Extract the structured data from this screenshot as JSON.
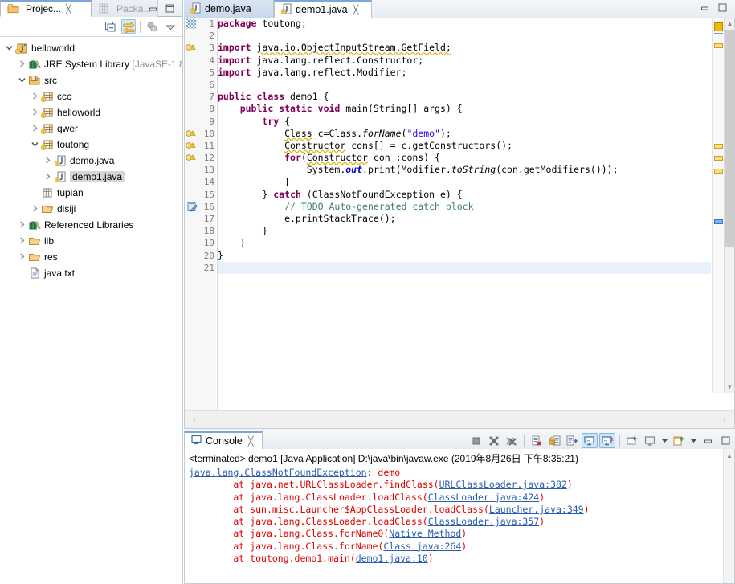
{
  "left_panel": {
    "tabs": [
      {
        "label": "Projec...",
        "icon": "project-explorer-icon",
        "active": true,
        "closable": true
      },
      {
        "label": "Packa...",
        "icon": "package-explorer-icon",
        "active": false,
        "closable": false
      }
    ],
    "window_controls": {
      "minimize": "minimize-icon",
      "maximize": "maximize-icon"
    },
    "toolbar": [
      {
        "name": "collapse-all-button",
        "icon": "collapse-all-icon",
        "selected": false
      },
      {
        "name": "link-with-editor-button",
        "icon": "link-editor-icon",
        "selected": true
      },
      {
        "name": "view-menu-button",
        "icon": "working-sets-icon",
        "selected": false
      },
      {
        "name": "view-dropdown-button",
        "icon": "chevron-down-icon",
        "selected": false
      }
    ],
    "tree": [
      {
        "label": "helloworld",
        "indent": 0,
        "twisty": "open",
        "icon": "java-project-icon",
        "selected": false
      },
      {
        "label": "JRE System Library",
        "suffix": " [JavaSE-1.8",
        "indent": 1,
        "twisty": "closed",
        "icon": "library-icon",
        "selected": false
      },
      {
        "label": "src",
        "indent": 1,
        "twisty": "open",
        "icon": "source-folder-icon",
        "selected": false
      },
      {
        "label": "ccc",
        "indent": 2,
        "twisty": "closed",
        "icon": "package-icon",
        "selected": false
      },
      {
        "label": "helloworld",
        "indent": 2,
        "twisty": "closed",
        "icon": "package-icon",
        "selected": false
      },
      {
        "label": "qwer",
        "indent": 2,
        "twisty": "closed",
        "icon": "package-icon",
        "selected": false
      },
      {
        "label": "toutong",
        "indent": 2,
        "twisty": "open",
        "icon": "package-icon",
        "selected": false
      },
      {
        "label": "demo.java",
        "indent": 3,
        "twisty": "closed",
        "icon": "java-file-icon",
        "selected": false
      },
      {
        "label": "demo1.java",
        "indent": 3,
        "twisty": "closed",
        "icon": "java-file-icon",
        "selected": true
      },
      {
        "label": "tupian",
        "indent": 2,
        "twisty": "none",
        "icon": "empty-package-icon",
        "selected": false
      },
      {
        "label": "disiji",
        "indent": 2,
        "twisty": "closed",
        "icon": "folder-icon",
        "selected": false
      },
      {
        "label": "Referenced Libraries",
        "indent": 1,
        "twisty": "closed",
        "icon": "library-icon",
        "selected": false
      },
      {
        "label": "lib",
        "indent": 1,
        "twisty": "closed",
        "icon": "folder-icon",
        "selected": false
      },
      {
        "label": "res",
        "indent": 1,
        "twisty": "closed",
        "icon": "folder-icon",
        "selected": false
      },
      {
        "label": "java.txt",
        "indent": 1,
        "twisty": "none",
        "icon": "text-file-icon",
        "selected": false
      }
    ]
  },
  "editor": {
    "tabs": [
      {
        "label": "demo.java",
        "active": false,
        "closable": false,
        "icon": "java-file-icon"
      },
      {
        "label": "demo1.java",
        "active": true,
        "closable": true,
        "icon": "java-file-icon"
      }
    ],
    "window_controls": {
      "minimize": "minimize-icon",
      "maximize": "maximize-icon"
    },
    "lines": [
      {
        "n": 1,
        "marker": "bookmark-stripe-icon",
        "tokens": [
          {
            "t": "package ",
            "c": "kw"
          },
          {
            "t": "toutong;",
            "c": ""
          }
        ]
      },
      {
        "n": 2,
        "marker": "",
        "tokens": []
      },
      {
        "n": 3,
        "marker": "warning-icon",
        "tokens": [
          {
            "t": "import ",
            "c": "kw"
          },
          {
            "t": "java.io.ObjectInputStream.GetField;",
            "c": "warnline"
          }
        ]
      },
      {
        "n": 4,
        "marker": "",
        "tokens": [
          {
            "t": "import ",
            "c": "kw"
          },
          {
            "t": "java.lang.reflect.Constructor;",
            "c": ""
          }
        ]
      },
      {
        "n": 5,
        "marker": "",
        "tokens": [
          {
            "t": "import ",
            "c": "kw"
          },
          {
            "t": "java.lang.reflect.Modifier;",
            "c": ""
          }
        ]
      },
      {
        "n": 6,
        "marker": "",
        "tokens": []
      },
      {
        "n": 7,
        "marker": "",
        "tokens": [
          {
            "t": "public ",
            "c": "kw"
          },
          {
            "t": "class ",
            "c": "kw"
          },
          {
            "t": "demo1 {",
            "c": ""
          }
        ]
      },
      {
        "n": 8,
        "marker": "",
        "tokens": [
          {
            "t": "    ",
            "c": ""
          },
          {
            "t": "public ",
            "c": "kw"
          },
          {
            "t": "static ",
            "c": "kw"
          },
          {
            "t": "void ",
            "c": "kw"
          },
          {
            "t": "main(String[] args) {",
            "c": ""
          }
        ]
      },
      {
        "n": 9,
        "marker": "",
        "tokens": [
          {
            "t": "        ",
            "c": ""
          },
          {
            "t": "try ",
            "c": "kw"
          },
          {
            "t": "{",
            "c": ""
          }
        ]
      },
      {
        "n": 10,
        "marker": "warning-icon",
        "tokens": [
          {
            "t": "            ",
            "c": ""
          },
          {
            "t": "Class",
            "c": "warnline"
          },
          {
            "t": " c=Class.",
            "c": ""
          },
          {
            "t": "forName",
            "c": "it"
          },
          {
            "t": "(",
            "c": ""
          },
          {
            "t": "\"demo\"",
            "c": "str"
          },
          {
            "t": ");",
            "c": ""
          }
        ]
      },
      {
        "n": 11,
        "marker": "warning-icon",
        "tokens": [
          {
            "t": "            ",
            "c": ""
          },
          {
            "t": "Constructor",
            "c": "warnline"
          },
          {
            "t": " cons[] = c.getConstructors();",
            "c": ""
          }
        ]
      },
      {
        "n": 12,
        "marker": "warning-icon",
        "tokens": [
          {
            "t": "            ",
            "c": ""
          },
          {
            "t": "for",
            "c": "kw"
          },
          {
            "t": "(",
            "c": ""
          },
          {
            "t": "Constructor",
            "c": "warnline"
          },
          {
            "t": " con :cons) {",
            "c": ""
          }
        ]
      },
      {
        "n": 13,
        "marker": "",
        "tokens": [
          {
            "t": "                System.",
            "c": ""
          },
          {
            "t": "out",
            "c": "fieldblue"
          },
          {
            "t": ".print(Modifier.",
            "c": ""
          },
          {
            "t": "toString",
            "c": "it"
          },
          {
            "t": "(con.getModifiers()));",
            "c": ""
          }
        ]
      },
      {
        "n": 14,
        "marker": "",
        "tokens": [
          {
            "t": "            }",
            "c": ""
          }
        ]
      },
      {
        "n": 15,
        "marker": "",
        "tokens": [
          {
            "t": "        } ",
            "c": ""
          },
          {
            "t": "catch ",
            "c": "kw"
          },
          {
            "t": "(ClassNotFoundException e) {",
            "c": ""
          }
        ]
      },
      {
        "n": 16,
        "marker": "todo-icon",
        "tokens": [
          {
            "t": "            ",
            "c": ""
          },
          {
            "t": "// TODO Auto-generated catch block",
            "c": "cmt"
          }
        ]
      },
      {
        "n": 17,
        "marker": "",
        "tokens": [
          {
            "t": "            e.printStackTrace();",
            "c": ""
          }
        ]
      },
      {
        "n": 18,
        "marker": "",
        "tokens": [
          {
            "t": "        }",
            "c": ""
          }
        ]
      },
      {
        "n": 19,
        "marker": "",
        "tokens": [
          {
            "t": "    }",
            "c": ""
          }
        ]
      },
      {
        "n": 20,
        "marker": "",
        "tokens": [
          {
            "t": "}",
            "c": ""
          }
        ]
      },
      {
        "n": 21,
        "marker": "",
        "current": true,
        "tokens": []
      }
    ],
    "scroll_left_arrow": "‹",
    "scroll_right_arrow": "›"
  },
  "console": {
    "tab_label": "Console",
    "tab_icon": "console-icon",
    "close_icon": "close-icon",
    "toolbar": [
      {
        "name": "terminate-button",
        "icon": "terminate-icon",
        "selected": false
      },
      {
        "name": "remove-launch-button",
        "icon": "remove-launch-icon",
        "selected": false
      },
      {
        "name": "remove-all-terminated-button",
        "icon": "remove-all-icon",
        "selected": false
      },
      {
        "name": "clear-console-button",
        "icon": "clear-console-icon",
        "selected": false
      },
      {
        "name": "scroll-lock-button",
        "icon": "scroll-lock-icon",
        "selected": false
      },
      {
        "name": "word-wrap-button",
        "icon": "word-wrap-icon",
        "selected": false
      },
      {
        "name": "show-console-on-output-button",
        "icon": "show-console-output-icon",
        "selected": true
      },
      {
        "name": "show-console-on-error-button",
        "icon": "show-console-error-icon",
        "selected": true
      },
      {
        "name": "pin-console-button",
        "icon": "pin-console-icon",
        "selected": false
      },
      {
        "name": "display-selected-console-button",
        "icon": "display-console-icon",
        "selected": false
      },
      {
        "name": "display-console-dropdown",
        "icon": "chevron-down-icon",
        "selected": false
      },
      {
        "name": "open-console-button",
        "icon": "open-console-icon",
        "selected": false
      },
      {
        "name": "open-console-dropdown",
        "icon": "chevron-down-icon",
        "selected": false
      },
      {
        "name": "minimize-button",
        "icon": "minimize-icon",
        "selected": false
      },
      {
        "name": "maximize-button",
        "icon": "maximize-icon",
        "selected": false
      }
    ],
    "header": "<terminated> demo1 [Java Application] D:\\java\\bin\\javaw.exe (2019年8月26日 下午8:35:21)",
    "stack": [
      {
        "parts": [
          {
            "t": "java.lang.ClassNotFoundException",
            "c": "exc"
          },
          {
            "t": ": ",
            "c": ""
          },
          {
            "t": "demo",
            "c": "red"
          }
        ]
      },
      {
        "parts": [
          {
            "t": "\tat ",
            "c": "red"
          },
          {
            "t": "java.net.URLClassLoader.findClass(",
            "c": "red"
          },
          {
            "t": "URLClassLoader.java:382",
            "c": "lnk"
          },
          {
            "t": ")",
            "c": "red"
          }
        ]
      },
      {
        "parts": [
          {
            "t": "\tat ",
            "c": "red"
          },
          {
            "t": "java.lang.ClassLoader.loadClass(",
            "c": "red"
          },
          {
            "t": "ClassLoader.java:424",
            "c": "lnk"
          },
          {
            "t": ")",
            "c": "red"
          }
        ]
      },
      {
        "parts": [
          {
            "t": "\tat ",
            "c": "red"
          },
          {
            "t": "sun.misc.Launcher$AppClassLoader.loadClass(",
            "c": "red"
          },
          {
            "t": "Launcher.java:349",
            "c": "lnk"
          },
          {
            "t": ")",
            "c": "red"
          }
        ]
      },
      {
        "parts": [
          {
            "t": "\tat ",
            "c": "red"
          },
          {
            "t": "java.lang.ClassLoader.loadClass(",
            "c": "red"
          },
          {
            "t": "ClassLoader.java:357",
            "c": "lnk"
          },
          {
            "t": ")",
            "c": "red"
          }
        ]
      },
      {
        "parts": [
          {
            "t": "\tat ",
            "c": "red"
          },
          {
            "t": "java.lang.Class.forName0(",
            "c": "red"
          },
          {
            "t": "Native Method",
            "c": "lnk"
          },
          {
            "t": ")",
            "c": "red"
          }
        ]
      },
      {
        "parts": [
          {
            "t": "\tat ",
            "c": "red"
          },
          {
            "t": "java.lang.Class.forName(",
            "c": "red"
          },
          {
            "t": "Class.java:264",
            "c": "lnk"
          },
          {
            "t": ")",
            "c": "red"
          }
        ]
      },
      {
        "parts": [
          {
            "t": "\tat ",
            "c": "red"
          },
          {
            "t": "toutong.demo1.main(",
            "c": "red"
          },
          {
            "t": "demo1.java:10",
            "c": "lnk"
          },
          {
            "t": ")",
            "c": "red"
          }
        ]
      }
    ]
  },
  "colors": {
    "keyword": "#7f0055",
    "string": "#2a00ff",
    "comment": "#3f7f5f",
    "error_red": "#e00000",
    "link_blue": "#2a5db0",
    "selection_gray": "#d6d6d6",
    "current_line": "#e8f0fb",
    "tab_active_top": "#7aa7d7"
  }
}
